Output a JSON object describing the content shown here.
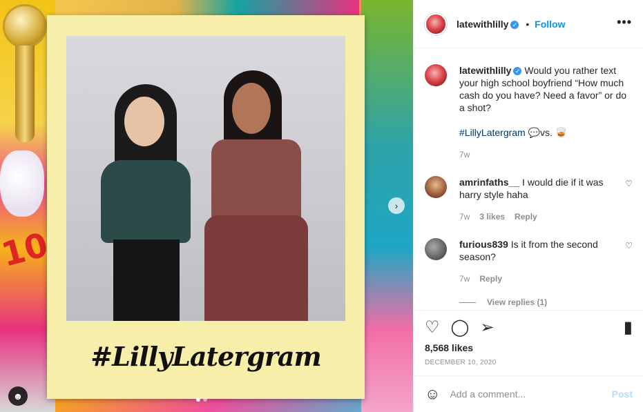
{
  "media": {
    "hashtag_text": "#LillyLatergram",
    "next_icon": "chevron-right-icon",
    "carousel_dots": 2,
    "carousel_active": 1,
    "tag_icon": "user-tag-icon"
  },
  "header": {
    "username": "latewithlilly",
    "separator": "•",
    "follow_label": "Follow",
    "more_label": "•••"
  },
  "caption": {
    "username": "latewithlilly",
    "text": "Would you rather text your high school boyfriend “How much cash do you have? Need a favor” or do a shot?",
    "hashtag": "#LillyLatergram",
    "suffix": "💬vs. 🥃",
    "time": "7w"
  },
  "comments": [
    {
      "username": "amrinfaths__",
      "text": "I would die if it was harry style haha",
      "time": "7w",
      "likes": "3 likes",
      "reply_label": "Reply"
    },
    {
      "username": "furious839",
      "text": "Is it from the second season?",
      "time": "7w",
      "reply_label": "Reply",
      "view_replies": "View replies (1)"
    }
  ],
  "actions": {
    "likes": "8,568 likes",
    "date": "DECEMBER 10, 2020"
  },
  "add_comment": {
    "placeholder": "Add a comment...",
    "post_label": "Post"
  },
  "colors": {
    "link_blue": "#0095f6",
    "hashtag": "#00376b",
    "muted": "#8e8e8e",
    "post_disabled": "#b2dffc"
  }
}
